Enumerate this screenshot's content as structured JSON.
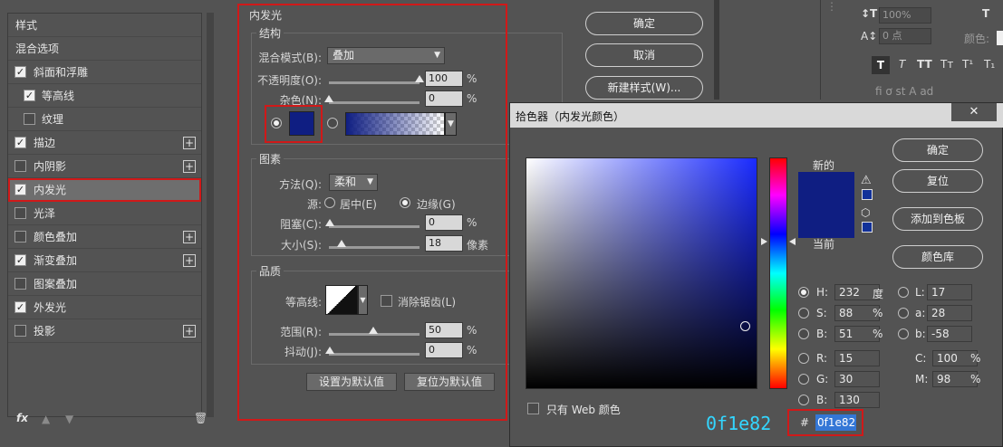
{
  "left_panel": {
    "items": [
      {
        "label": "样式",
        "checkbox": "none",
        "plus": false
      },
      {
        "label": "混合选项",
        "checkbox": "none",
        "plus": false
      },
      {
        "label": "斜面和浮雕",
        "checkbox": "on",
        "plus": false
      },
      {
        "label": "等高线",
        "checkbox": "on",
        "plus": false,
        "indent": true
      },
      {
        "label": "纹理",
        "checkbox": "off",
        "plus": false,
        "indent": true
      },
      {
        "label": "描边",
        "checkbox": "on",
        "plus": true
      },
      {
        "label": "内阴影",
        "checkbox": "off",
        "plus": true
      },
      {
        "label": "内发光",
        "checkbox": "on",
        "plus": false,
        "selected": true
      },
      {
        "label": "光泽",
        "checkbox": "off",
        "plus": false
      },
      {
        "label": "颜色叠加",
        "checkbox": "off",
        "plus": true
      },
      {
        "label": "渐变叠加",
        "checkbox": "on",
        "plus": true
      },
      {
        "label": "图案叠加",
        "checkbox": "off",
        "plus": false
      },
      {
        "label": "外发光",
        "checkbox": "on",
        "plus": false
      },
      {
        "label": "投影",
        "checkbox": "off",
        "plus": true
      }
    ],
    "footer_fx": "fx"
  },
  "inner_glow": {
    "title": "内发光",
    "structure": {
      "title": "结构",
      "blend_mode_label": "混合模式(B):",
      "blend_mode_value": "叠加",
      "opacity_label": "不透明度(O):",
      "opacity_value": "100",
      "opacity_unit": "%",
      "opacity_level": 1.0,
      "noise_label": "杂色(N):",
      "noise_value": "0",
      "noise_unit": "%",
      "noise_level": 0.0
    },
    "elements": {
      "title": "图素",
      "method_label": "方法(Q):",
      "method_value": "柔和",
      "source_label": "源:",
      "source_center": "居中(E)",
      "source_edge": "边缘(G)",
      "choke_label": "阻塞(C):",
      "choke_value": "0",
      "choke_unit": "%",
      "size_label": "大小(S):",
      "size_value": "18",
      "size_unit": "像素"
    },
    "quality": {
      "title": "品质",
      "contour_label": "等高线:",
      "antialias_label": "消除锯齿(L)",
      "range_label": "范围(R):",
      "range_value": "50",
      "range_unit": "%",
      "jitter_label": "抖动(J):",
      "jitter_value": "0",
      "jitter_unit": "%"
    },
    "set_default": "设置为默认值",
    "reset_default": "复位为默认值",
    "glow_color": "#0f1e82"
  },
  "main_buttons": {
    "ok": "确定",
    "cancel": "取消",
    "new_style": "新建样式(W)..."
  },
  "char_panel": {
    "tracking_value": "100%",
    "baseline_value": "0 点",
    "color_label": "颜色:"
  },
  "picker": {
    "title": "拾色器（内发光颜色）",
    "new_label": "新的",
    "current_label": "当前",
    "buttons": {
      "ok": "确定",
      "reset": "复位",
      "add_swatch": "添加到色板",
      "library": "颜色库"
    },
    "web_only": "只有 Web 颜色",
    "fields": {
      "H": {
        "label": "H:",
        "value": "232",
        "unit": "度"
      },
      "S": {
        "label": "S:",
        "value": "88",
        "unit": "%"
      },
      "B": {
        "label": "B:",
        "value": "51",
        "unit": "%"
      },
      "R": {
        "label": "R:",
        "value": "15"
      },
      "G": {
        "label": "G:",
        "value": "30"
      },
      "Bl": {
        "label": "B:",
        "value": "130"
      },
      "L": {
        "label": "L:",
        "value": "17"
      },
      "a": {
        "label": "a:",
        "value": "28"
      },
      "b": {
        "label": "b:",
        "value": "-58"
      },
      "C": {
        "label": "C:",
        "value": "100",
        "unit": "%"
      },
      "M": {
        "label": "M:",
        "value": "98",
        "unit": "%"
      }
    },
    "hex_label": "#",
    "hex_value": "0f1e82",
    "hex_overlay": "0f1e82",
    "current_color": "#0f1e82"
  }
}
